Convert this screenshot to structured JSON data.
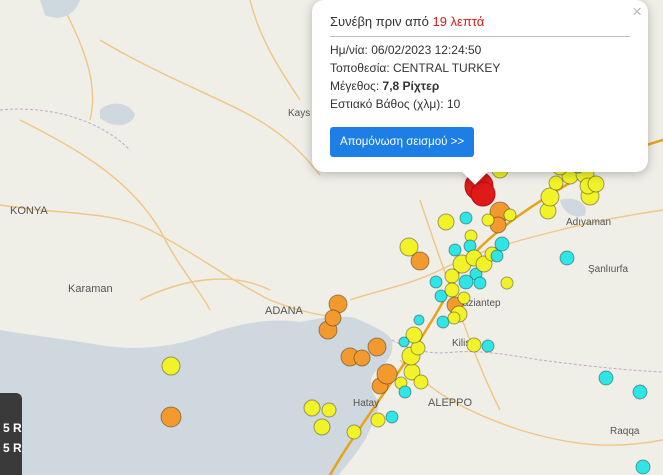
{
  "map": {
    "cities": [
      "KONYA",
      "Karaman",
      "ADANA",
      "Kays",
      "Adıyaman",
      "Şanlıurfa",
      "Gaziantep",
      "Kilis",
      "Hatay",
      "ALEPPO",
      "Raqqa"
    ]
  },
  "popup": {
    "headline_prefix": "Συνέβη πριν από",
    "headline_time": "19 λεπτά",
    "close_glyph": "×",
    "date_label": "Ημ/νία:",
    "date_value": "06/02/2023 12:24:50",
    "location_label": "Τοποθεσία:",
    "location_value": "CENTRAL TURKEY",
    "magnitude_label": "Μέγεθος:",
    "magnitude_value": "7,8 Ρίχτερ",
    "depth_label": "Εστιακό Βάθος (χλμ):",
    "depth_value": "10",
    "isolate_button": "Απομόνωση σεισμού >>"
  },
  "legend": {
    "line1": "5 R",
    "line2": "5 R"
  },
  "colors": {
    "red": "#e01919",
    "orange": "#f29a2e",
    "yellow": "#f2f229",
    "cyan": "#2ee6e6",
    "button": "#1d7fe6",
    "sea": "#cfd8df"
  }
}
